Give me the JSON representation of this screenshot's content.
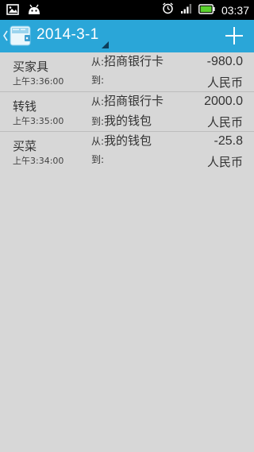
{
  "status_bar": {
    "time": "03:37",
    "icons": [
      "gallery-notification-icon",
      "android-debug-icon",
      "alarm-icon",
      "signal-icon",
      "battery-icon"
    ]
  },
  "action_bar": {
    "date": "2014-3-1",
    "accent_color": "#2aa6d8",
    "icons": [
      "back-chevron-icon",
      "wallet-app-icon",
      "add-icon"
    ]
  },
  "transactions": [
    {
      "name": "买家具",
      "time": "上午3:36:00",
      "from_prefix": "从:",
      "from": "招商银行卡",
      "to_prefix": "到:",
      "to": "",
      "amount": "-980.0",
      "currency": "人民币"
    },
    {
      "name": "转钱",
      "time": "上午3:35:00",
      "from_prefix": "从:",
      "from": "招商银行卡",
      "to_prefix": "到:",
      "to": "我的钱包",
      "amount": "2000.0",
      "currency": "人民币"
    },
    {
      "name": "买菜",
      "time": "上午3:34:00",
      "from_prefix": "从:",
      "from": "我的钱包",
      "to_prefix": "到:",
      "to": "",
      "amount": "-25.8",
      "currency": "人民币"
    }
  ]
}
